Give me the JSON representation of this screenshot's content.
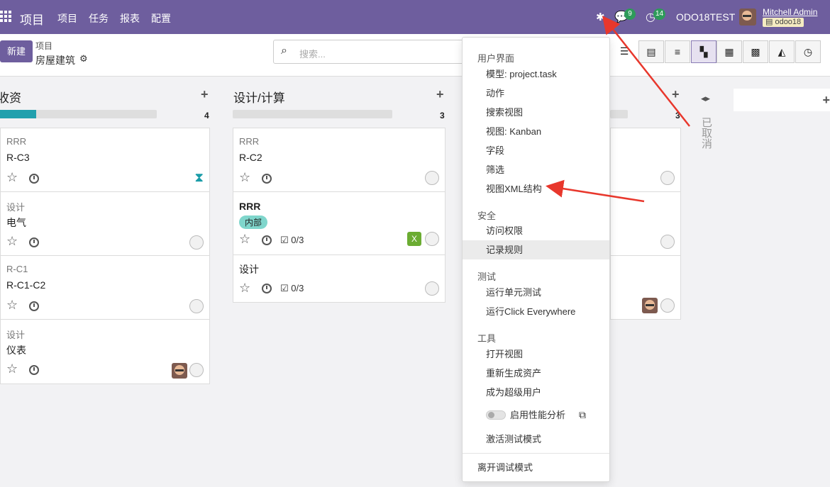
{
  "topbar": {
    "brand": "项目",
    "menu": [
      "项目",
      "任务",
      "报表",
      "配置"
    ],
    "chat_badge": "9",
    "activity_badge": "14",
    "db_name": "ODO18TEST",
    "user_name": "Mitchell Admin",
    "db_chip": "odoo18"
  },
  "control": {
    "new_label": "新建",
    "breadcrumb_parent": "项目",
    "breadcrumb_current": "房屋建筑",
    "search_placeholder": "搜索..."
  },
  "columns": [
    {
      "title": "收资",
      "count": "4",
      "progress": 0.23,
      "cards": [
        {
          "project": "RRR",
          "name": "R-C3"
        },
        {
          "project": "设计",
          "name": "电气"
        },
        {
          "project": "R-C1",
          "name": "R-C1-C2"
        },
        {
          "project": "设计",
          "name": "仪表"
        }
      ]
    },
    {
      "title": "设计/计算",
      "count": "3",
      "progress": 0,
      "cards": [
        {
          "project": "RRR",
          "name": "R-C2"
        },
        {
          "name": "RRR",
          "tag": "内部",
          "checklist": "0/3",
          "chip": "X"
        },
        {
          "name": "设计",
          "checklist": "0/3"
        }
      ]
    },
    {
      "count": "3"
    }
  ],
  "folded_column": "已取消",
  "debug_menu": {
    "sections": [
      {
        "header": "用户界面",
        "items": [
          "模型: project.task",
          "动作",
          "搜索视图",
          "视图: Kanban",
          "字段",
          "筛选",
          "视图XML结构"
        ]
      },
      {
        "header": "安全",
        "items": [
          "访问权限",
          "记录规则"
        ]
      },
      {
        "header": "测试",
        "items": [
          "运行单元测试",
          "运行Click Everywhere"
        ]
      },
      {
        "header": "工具",
        "items": [
          "打开视图",
          "重新生成资产",
          "成为超级用户",
          "启用性能分析",
          "激活测试模式"
        ]
      }
    ],
    "leave": "离开调试模式"
  },
  "colors": {
    "brand": "#6e5e9e",
    "progress": "#21a0ad",
    "badge": "#2e9b5a",
    "arrow": "#e8372c"
  }
}
